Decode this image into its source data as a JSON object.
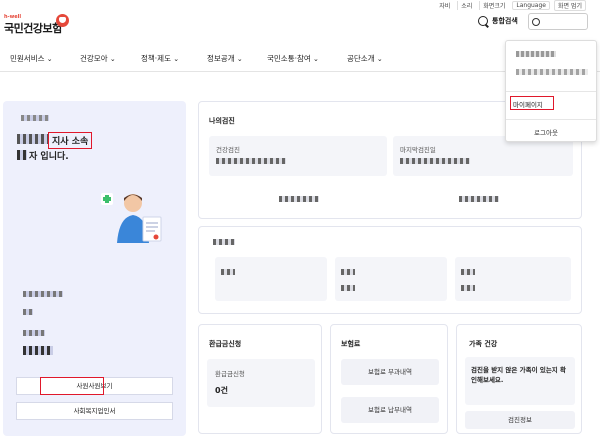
{
  "util_bar": [
    "자비",
    "소리",
    "화면크기",
    "Language",
    "화면 멈기"
  ],
  "logo": {
    "sub": "h-well",
    "main": "국민건강보험"
  },
  "header": {
    "search_label": "통합검색",
    "user_name": ""
  },
  "gnb": [
    "민원서비스",
    "건강모아",
    "정책·제도",
    "정보공개",
    "국민소통·참여",
    "공단소개"
  ],
  "dropdown": {
    "mypage": "마이페이지",
    "logout": "로그아웃"
  },
  "profile": {
    "affiliation": "지사 소속",
    "greeting": "자 입니다.",
    "buttons": [
      "사원사원보기",
      "사회복지업인서"
    ]
  },
  "cards": {
    "my_checkup": {
      "title": "나의검진",
      "left_label": "건강검진",
      "right_label": "마지막검진일"
    },
    "refund": {
      "title": "환급금신청",
      "box_label": "환급금신청",
      "amount": "0건"
    },
    "insurance": {
      "title": "보험료",
      "btn1": "보험료 부과내역",
      "btn2": "보험료 납부내역"
    },
    "family": {
      "title": "가족 건강",
      "notice": "검진을 받지 않은 가족이 있는지 확인해보세요.",
      "btn": "검진정보"
    }
  }
}
